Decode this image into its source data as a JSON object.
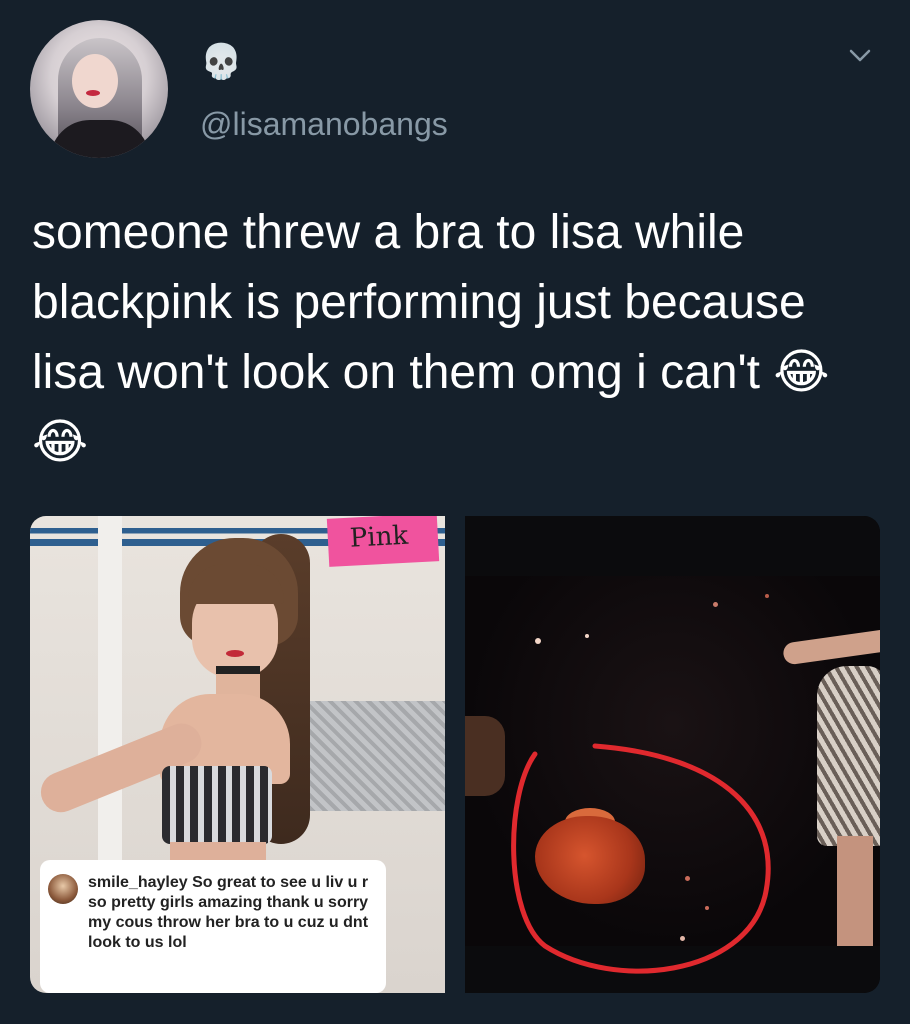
{
  "author": {
    "display_name": "💀",
    "handle": "@lisamanobangs"
  },
  "tweet": {
    "text": "someone threw a bra to lisa while blackpink is performing just because lisa won't look on them omg i can't 😂😂"
  },
  "media": {
    "left_sign_text": "Pink",
    "comment": {
      "username": "smile_hayley",
      "text": "So great to see u liv u r so pretty girls amazing thank u sorry my cous throw her bra to u cuz u dnt look to us lol"
    }
  },
  "icons": {
    "menu": "chevron-down-icon"
  },
  "colors": {
    "background": "#15202b",
    "text": "#ffffff",
    "secondary_text": "#8899a6",
    "highlight_circle": "#e0292e"
  }
}
